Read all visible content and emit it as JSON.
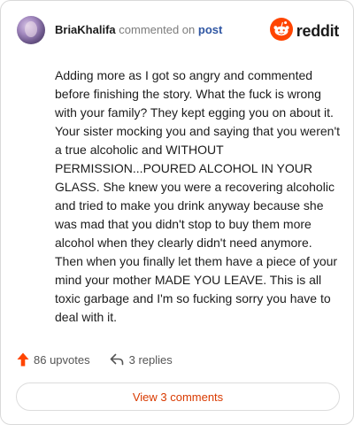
{
  "header": {
    "username": "BriaKhalifa",
    "commented_text": "commented on",
    "post_link": "post",
    "brand": "reddit"
  },
  "comment": {
    "text": "Adding more as I got so angry and commented before finishing the story. What the fuck is wrong with your family? They kept egging you on about it. Your sister mocking you and saying that you weren't a true alcoholic and WITHOUT PERMISSION...POURED ALCOHOL IN YOUR GLASS. She knew you were a recovering alcoholic and tried to make you drink anyway because she was mad that you didn't stop to buy them more alcohol when they clearly didn't need anymore. Then when you finally let them have a piece of your mind your mother MADE YOU LEAVE. This is all toxic garbage and I'm so fucking sorry you have to deal with it."
  },
  "actions": {
    "upvotes": "86 upvotes",
    "replies": "3 replies"
  },
  "footer": {
    "view_comments": "View 3 comments"
  },
  "colors": {
    "brand_orange": "#ff4500",
    "link_blue": "#2f56a3",
    "button_text": "#d93a00"
  },
  "icons": [
    "avatar",
    "reddit-logo-icon",
    "upvote-arrow-icon",
    "reply-arrow-icon"
  ]
}
